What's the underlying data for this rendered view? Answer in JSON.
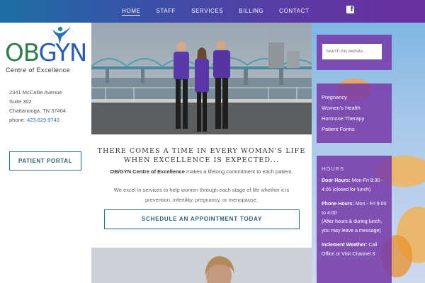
{
  "nav": {
    "items": [
      {
        "label": "HOME",
        "active": true
      },
      {
        "label": "STAFF",
        "active": false
      },
      {
        "label": "SERVICES",
        "active": false
      },
      {
        "label": "BILLING",
        "active": false
      },
      {
        "label": "CONTACT",
        "active": false
      }
    ],
    "facebook_glyph": "f",
    "facebook_icon": "facebook-icon"
  },
  "logo": {
    "ob": "OB",
    "gyn": "GYN",
    "sub": "Centre of Excellence",
    "colors": {
      "ob": "#2e7d4b",
      "gyn": "#2a5db0"
    }
  },
  "address": {
    "line1": "2341 McCallie Avenue",
    "line2": "Suite 302",
    "line3": "Chattanooga, TN 37404",
    "phone_label": "phone:",
    "phone_number": "423.629.9743"
  },
  "portal_button": "PATIENT PORTAL",
  "main": {
    "slogan_line1": "THERE COMES A TIME IN EVERY WOMAN'S LIFE",
    "slogan_line2": "WHEN EXCELLENCE IS EXPECTED...",
    "intro_bold": "OB/GYN Centre of Excellence",
    "intro_rest": " makes a lifelong commitment to each patient.",
    "paragraph": "We excel in services to help women through each stage of life whether it is prevention, infertility, pregnancy, or menopause.",
    "schedule_button": "SCHEDULE AN APPOINTMENT TODAY"
  },
  "sidebar": {
    "search_placeholder": "Search this website...",
    "links": [
      "Pregnancy",
      "Women's Health",
      "Hormone Therapy",
      "Patient Forms"
    ],
    "hours_title": "HOURS",
    "door_label": "Door Hours:",
    "door_text": " Mon-Fri 8:30 - 4:00 (closed for lunch)",
    "phone_label": "Phone Hours:",
    "phone_text": " Mon - Fri 9:00 to 4:00",
    "phone_note": "(After hours & during lunch, you may leave a message)",
    "weather_label": "Inclement Weather:",
    "weather_text": " Call Office or Visit Channel 3"
  },
  "colors": {
    "accent": "#2a6f8e",
    "widget": "#7a3caa",
    "nav_start": "#1d6fa3",
    "nav_end": "#6a2f9e"
  }
}
